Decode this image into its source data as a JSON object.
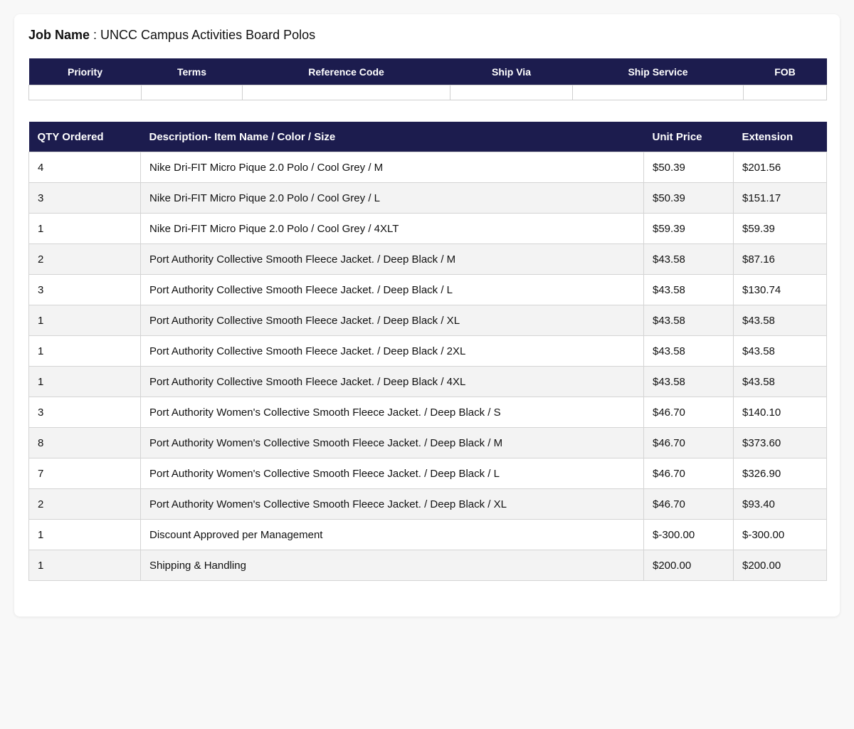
{
  "job": {
    "label": "Job Name",
    "separator": " : ",
    "value": "UNCC Campus Activities Board Polos"
  },
  "meta": {
    "headers": [
      "Priority",
      "Terms",
      "Reference Code",
      "Ship Via",
      "Ship Service",
      "FOB"
    ],
    "values": [
      "",
      "",
      "",
      "",
      "",
      ""
    ]
  },
  "items": {
    "headers": [
      "QTY Ordered",
      "Description- Item Name / Color / Size",
      "Unit Price",
      "Extension"
    ],
    "rows": [
      [
        "4",
        "Nike Dri-FIT Micro Pique 2.0 Polo / Cool Grey / M",
        "$50.39",
        "$201.56"
      ],
      [
        "3",
        "Nike Dri-FIT Micro Pique 2.0 Polo / Cool Grey / L",
        "$50.39",
        "$151.17"
      ],
      [
        "1",
        "Nike Dri-FIT Micro Pique 2.0 Polo / Cool Grey / 4XLT",
        "$59.39",
        "$59.39"
      ],
      [
        "2",
        "Port Authority Collective Smooth Fleece Jacket. / Deep Black / M",
        "$43.58",
        "$87.16"
      ],
      [
        "3",
        "Port Authority Collective Smooth Fleece Jacket. / Deep Black / L",
        "$43.58",
        "$130.74"
      ],
      [
        "1",
        "Port Authority Collective Smooth Fleece Jacket. / Deep Black / XL",
        "$43.58",
        "$43.58"
      ],
      [
        "1",
        "Port Authority Collective Smooth Fleece Jacket. / Deep Black / 2XL",
        "$43.58",
        "$43.58"
      ],
      [
        "1",
        "Port Authority Collective Smooth Fleece Jacket. / Deep Black / 4XL",
        "$43.58",
        "$43.58"
      ],
      [
        "3",
        "Port Authority Women's Collective Smooth Fleece Jacket. / Deep Black / S",
        "$46.70",
        "$140.10"
      ],
      [
        "8",
        "Port Authority Women's Collective Smooth Fleece Jacket. / Deep Black / M",
        "$46.70",
        "$373.60"
      ],
      [
        "7",
        "Port Authority Women's Collective Smooth Fleece Jacket. / Deep Black / L",
        "$46.70",
        "$326.90"
      ],
      [
        "2",
        "Port Authority Women's Collective Smooth Fleece Jacket. / Deep Black / XL",
        "$46.70",
        "$93.40"
      ],
      [
        "1",
        "Discount Approved per Management",
        "$-300.00",
        "$-300.00"
      ],
      [
        "1",
        "Shipping & Handling",
        "$200.00",
        "$200.00"
      ]
    ]
  },
  "colors": {
    "header_bg": "#1c1c4e",
    "alt_row_bg": "#f3f3f3"
  }
}
